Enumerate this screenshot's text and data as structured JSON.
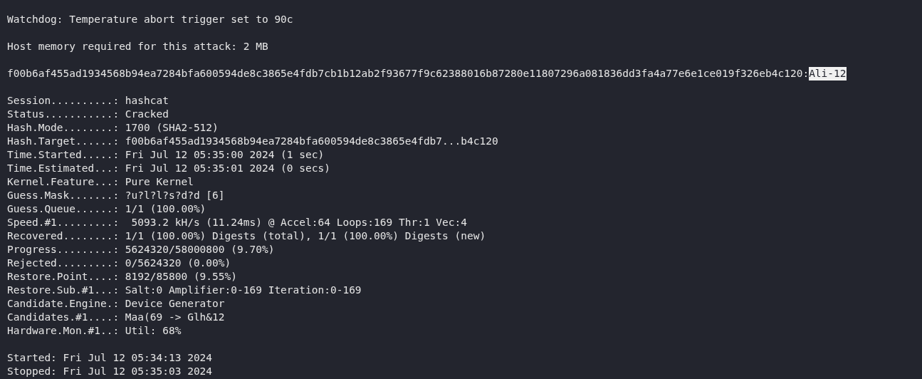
{
  "terminal": {
    "lines": [
      {
        "kind": "text",
        "text": "Watchdog: Temperature abort trigger set to 90c"
      },
      {
        "kind": "blank"
      },
      {
        "kind": "text",
        "text": "Host memory required for this attack: 2 MB"
      },
      {
        "kind": "blank"
      },
      {
        "kind": "cracked",
        "hash": "f00b6af455ad1934568b94ea7284bfa600594de8c3865e4fdb7cb1b12ab2f93677f9c62388016b87280e11807296a081836dd3fa4a77e6e1ce019f326eb4c120:",
        "password": "Ali-12",
        "selected": true
      },
      {
        "kind": "blank"
      },
      {
        "kind": "text",
        "text": "Session..........: hashcat"
      },
      {
        "kind": "text",
        "text": "Status...........: Cracked"
      },
      {
        "kind": "text",
        "text": "Hash.Mode........: 1700 (SHA2-512)"
      },
      {
        "kind": "text",
        "text": "Hash.Target......: f00b6af455ad1934568b94ea7284bfa600594de8c3865e4fdb7...b4c120"
      },
      {
        "kind": "text",
        "text": "Time.Started.....: Fri Jul 12 05:35:00 2024 (1 sec)"
      },
      {
        "kind": "text",
        "text": "Time.Estimated...: Fri Jul 12 05:35:01 2024 (0 secs)"
      },
      {
        "kind": "text",
        "text": "Kernel.Feature...: Pure Kernel"
      },
      {
        "kind": "text",
        "text": "Guess.Mask.......: ?u?l?l?s?d?d [6]"
      },
      {
        "kind": "text",
        "text": "Guess.Queue......: 1/1 (100.00%)"
      },
      {
        "kind": "text",
        "text": "Speed.#1.........:  5093.2 kH/s (11.24ms) @ Accel:64 Loops:169 Thr:1 Vec:4"
      },
      {
        "kind": "text",
        "text": "Recovered........: 1/1 (100.00%) Digests (total), 1/1 (100.00%) Digests (new)"
      },
      {
        "kind": "text",
        "text": "Progress.........: 5624320/58000800 (9.70%)"
      },
      {
        "kind": "text",
        "text": "Rejected.........: 0/5624320 (0.00%)"
      },
      {
        "kind": "text",
        "text": "Restore.Point....: 8192/85800 (9.55%)"
      },
      {
        "kind": "text",
        "text": "Restore.Sub.#1...: Salt:0 Amplifier:0-169 Iteration:0-169"
      },
      {
        "kind": "text",
        "text": "Candidate.Engine.: Device Generator"
      },
      {
        "kind": "text",
        "text": "Candidates.#1....: Maa(69 -> Glh&12"
      },
      {
        "kind": "text",
        "text": "Hardware.Mon.#1..: Util: 68%"
      },
      {
        "kind": "blank"
      },
      {
        "kind": "text",
        "text": "Started: Fri Jul 12 05:34:13 2024"
      },
      {
        "kind": "text",
        "text": "Stopped: Fri Jul 12 05:35:03 2024"
      }
    ]
  }
}
